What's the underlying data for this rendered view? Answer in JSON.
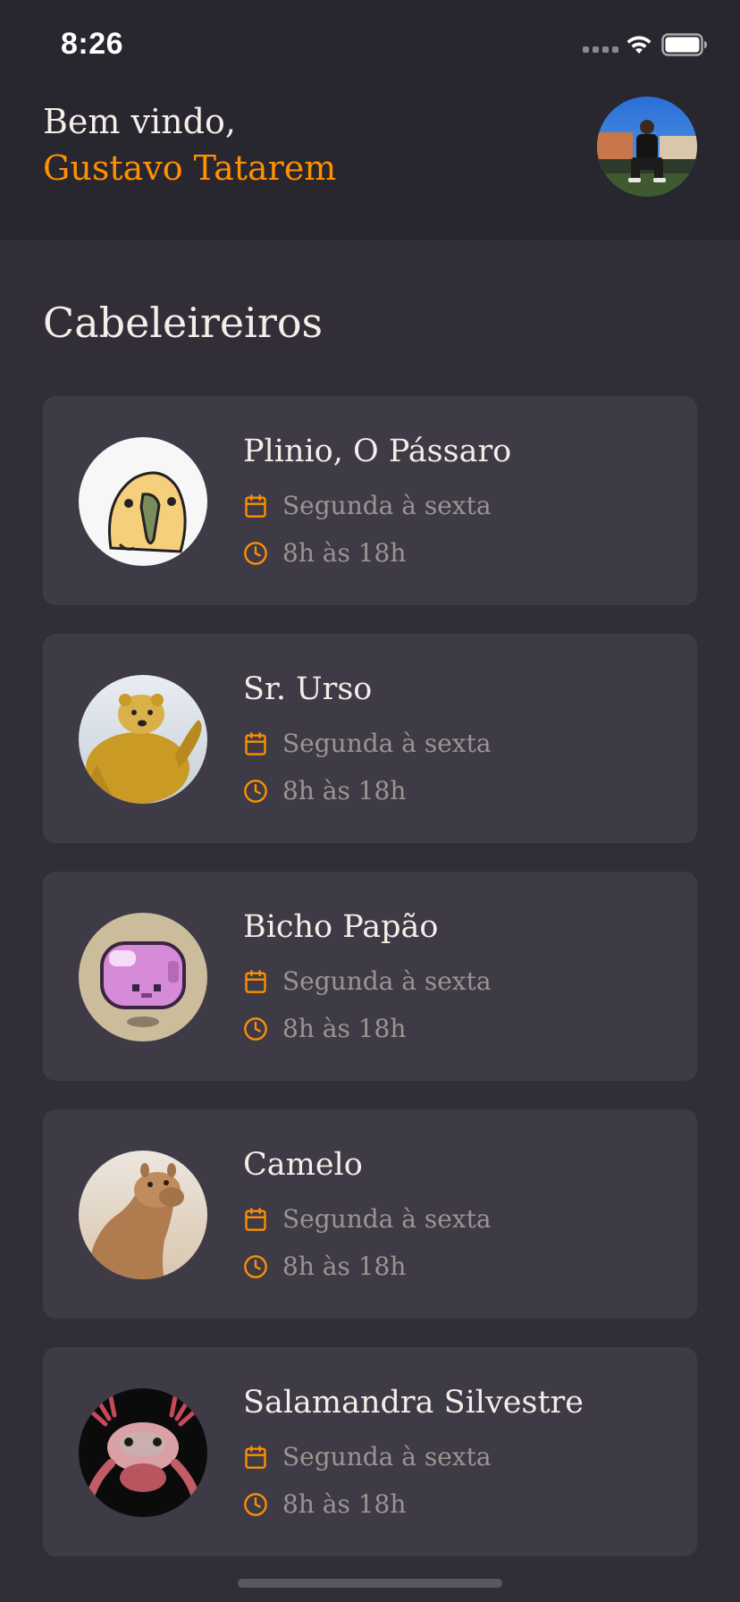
{
  "status_bar": {
    "time": "8:26"
  },
  "header": {
    "greeting": "Bem vindo,",
    "user_name": "Gustavo Tatarem"
  },
  "section": {
    "title": "Cabeleireiros"
  },
  "providers": [
    {
      "name": "Plinio, O Pássaro",
      "days": "Segunda à sexta",
      "hours": "8h às 18h"
    },
    {
      "name": "Sr. Urso",
      "days": "Segunda à sexta",
      "hours": "8h às 18h"
    },
    {
      "name": "Bicho Papão",
      "days": "Segunda à sexta",
      "hours": "8h às 18h"
    },
    {
      "name": "Camelo",
      "days": "Segunda à sexta",
      "hours": "8h às 18h"
    },
    {
      "name": "Salamandra Silvestre",
      "days": "Segunda à sexta",
      "hours": "8h às 18h"
    }
  ],
  "icons": {
    "calendar": "calendar-icon",
    "clock": "clock-icon"
  },
  "colors": {
    "background": "#312e38",
    "header": "#28262e",
    "card": "#3e3b47",
    "accent": "#ff9000",
    "text": "#f4ede8",
    "muted": "#999591"
  }
}
